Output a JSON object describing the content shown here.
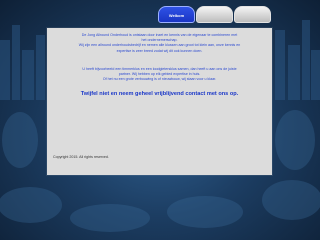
{
  "nav": {
    "tabs": [
      {
        "label": "Welkom",
        "active": true
      },
      {
        "label": "",
        "active": false
      },
      {
        "label": "",
        "active": false
      }
    ]
  },
  "intro": {
    "lines": [
      "De Jong Allround Onderhoud is ontstaan door inzet en kennis van de eigenaar te combineren met",
      "het ondernemerschap.",
      "Wij zijn een allround onderhoudsbedrijf en nemen alle klussen aan groot tot klein aan, onze kennis en",
      "expertise is zeer breed zodat wij dit ook kunnen doen."
    ]
  },
  "team": {
    "lines": [
      "U heeft bijvoorbeeld een timmerklus en een loodgietersklus samen, dan heeft u aan ons de juiste",
      "partner. Wij hebben op elk gebied expertise in huis.",
      "Of het nu een grote verbouwing is of nieuwbouw, wij staan voor u klaar."
    ]
  },
  "cta_text": "Twijfel niet en neem geheel vrijblijvend contact met ons op.",
  "copyright": "Copyright 2015. All rights reserved.",
  "colors": {
    "accent_text": "#2a48d0",
    "active_tab": "#1f3fd6",
    "panel": "#dcdcdc"
  }
}
